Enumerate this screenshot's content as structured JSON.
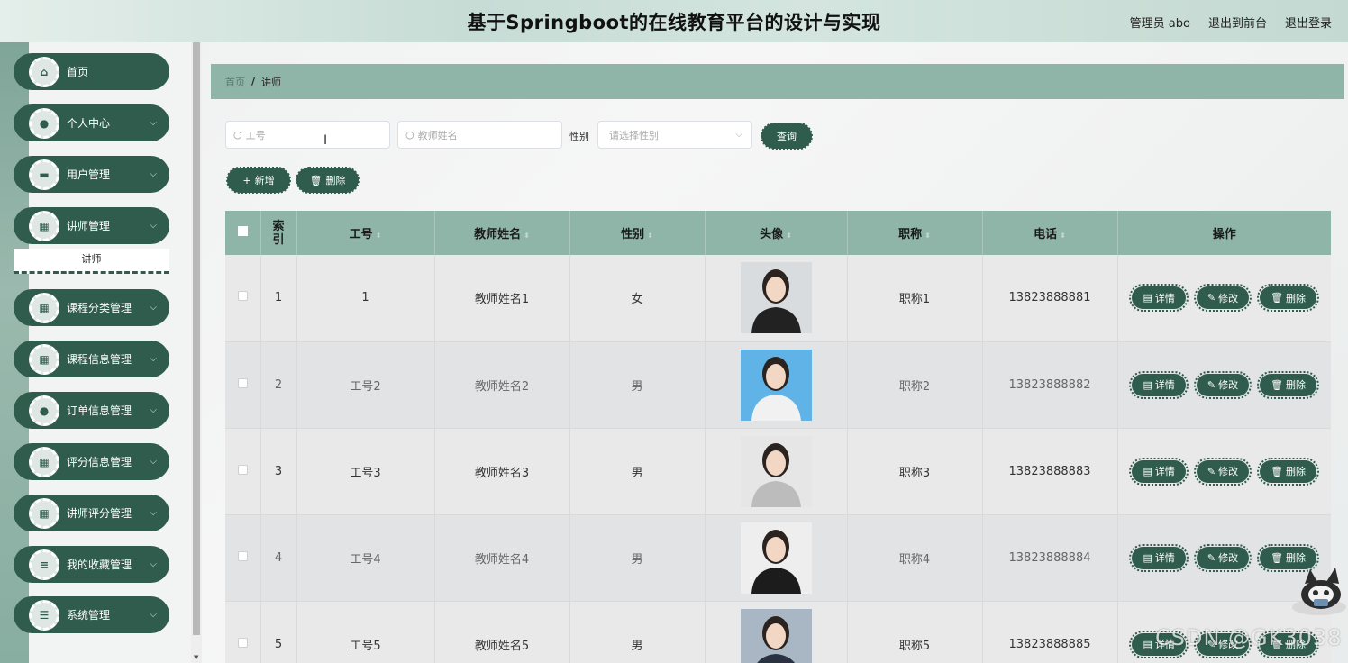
{
  "header": {
    "title": "基于Springboot的在线教育平台的设计与实现",
    "user": "管理员 abo",
    "back_front": "退出到前台",
    "logout": "退出登录"
  },
  "sidebar": {
    "items": [
      {
        "label": "首页",
        "icon": "home-icon",
        "glyph": "⌂",
        "chevron": false
      },
      {
        "label": "个人中心",
        "icon": "user-icon",
        "glyph": "●",
        "chevron": true
      },
      {
        "label": "用户管理",
        "icon": "monitor-icon",
        "glyph": "▬",
        "chevron": true
      },
      {
        "label": "讲师管理",
        "icon": "grid-icon",
        "glyph": "▦",
        "chevron": true
      },
      {
        "label": "课程分类管理",
        "icon": "grid-icon",
        "glyph": "▦",
        "chevron": true
      },
      {
        "label": "课程信息管理",
        "icon": "grid-icon",
        "glyph": "▦",
        "chevron": true
      },
      {
        "label": "订单信息管理",
        "icon": "user-icon",
        "glyph": "●",
        "chevron": true
      },
      {
        "label": "评分信息管理",
        "icon": "apps-icon",
        "glyph": "▦",
        "chevron": true
      },
      {
        "label": "讲师评分管理",
        "icon": "grid-icon",
        "glyph": "▦",
        "chevron": true
      },
      {
        "label": "我的收藏管理",
        "icon": "list-icon",
        "glyph": "≡",
        "chevron": true
      },
      {
        "label": "系统管理",
        "icon": "sliders-icon",
        "glyph": "☰",
        "chevron": true
      }
    ],
    "submenu_label": "讲师"
  },
  "breadcrumb": {
    "home": "首页",
    "sep": "/",
    "current": "讲师"
  },
  "search": {
    "id_placeholder": "工号",
    "name_placeholder": "教师姓名",
    "gender_label": "性别",
    "gender_placeholder": "请选择性别",
    "query_label": "查询"
  },
  "actions": {
    "add_label": "新增",
    "delete_label": "删除"
  },
  "table": {
    "headers": [
      "索引",
      "工号",
      "教师姓名",
      "性别",
      "头像",
      "职称",
      "电话",
      "操作"
    ],
    "rows": [
      {
        "index": "1",
        "id": "1",
        "name": "教师姓名1",
        "gender": "女",
        "title": "职称1",
        "phone": "13823888881",
        "avatar_bg": "#d9dcdf",
        "avatar_fg": "#222222"
      },
      {
        "index": "2",
        "id": "工号2",
        "name": "教师姓名2",
        "gender": "男",
        "title": "职称2",
        "phone": "13823888882",
        "avatar_bg": "#5fb3e6",
        "avatar_fg": "#f1f1f1"
      },
      {
        "index": "3",
        "id": "工号3",
        "name": "教师姓名3",
        "gender": "男",
        "title": "职称3",
        "phone": "13823888883",
        "avatar_bg": "#e6e6e6",
        "avatar_fg": "#bcbcbc"
      },
      {
        "index": "4",
        "id": "工号4",
        "name": "教师姓名4",
        "gender": "男",
        "title": "职称4",
        "phone": "13823888884",
        "avatar_bg": "#eeeeee",
        "avatar_fg": "#1c1c1c"
      },
      {
        "index": "5",
        "id": "工号5",
        "name": "教师姓名5",
        "gender": "男",
        "title": "职称5",
        "phone": "13823888885",
        "avatar_bg": "#a9b6c3",
        "avatar_fg": "#2a3140"
      }
    ],
    "op_detail": "详情",
    "op_edit": "修改",
    "op_delete": "删除"
  },
  "watermark": "CSDN @GK3038",
  "colors": {
    "primary": "#2f5c4c",
    "header_row": "#8eb5a7"
  }
}
